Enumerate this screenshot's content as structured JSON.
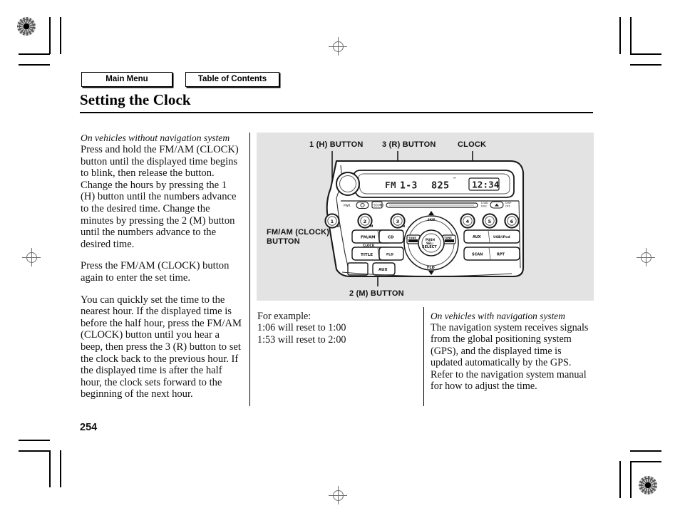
{
  "nav": {
    "main_menu": "Main Menu",
    "table_of_contents": "Table of Contents"
  },
  "header": {
    "title": "Setting the Clock"
  },
  "left_column": {
    "subhead": "On vehicles without navigation system",
    "paragraph_1": "Press and hold the FM/AM (CLOCK) button until the displayed time begins to blink, then release the button. Change the hours by pressing the 1 (H) button until the numbers advance to the desired time. Change the minutes by pressing the 2 (M) button until the numbers advance to the desired time.",
    "paragraph_2": "Press the FM/AM (CLOCK) button again to enter the set time.",
    "paragraph_3": "You can quickly set the time to the nearest hour. If the displayed time is before the half hour, press the FM/AM (CLOCK) button until you hear a beep, then press the 3 (R) button to set the clock back to the previous hour. If the displayed time is after the half hour, the clock sets forward to the beginning of the next hour."
  },
  "figure": {
    "labels": {
      "button_1h": "1 (H) BUTTON",
      "button_3r": "3 (R) BUTTON",
      "clock": "CLOCK",
      "fm_am_clock_line1": "FM/AM (CLOCK)",
      "fm_am_clock_line2": "BUTTON",
      "button_2m": "2 (M) BUTTON"
    },
    "display": {
      "band": "FM",
      "preset": "1-3",
      "frequency": "825",
      "unit": "″",
      "clock_time": "12:34"
    },
    "preset_buttons": [
      "1",
      "2",
      "3",
      "4",
      "5",
      "6"
    ],
    "preset_sublabels": [
      "H",
      "M",
      "R",
      "",
      "",
      ""
    ],
    "soft_buttons": {
      "fm_am": "FM/AM",
      "fm_am_sub": "CLOCK",
      "cd": "CD",
      "title": "TITLE",
      "folder": "FLD",
      "aux_right": "AUX",
      "usb_ipod": "USB/iPod",
      "scan": "SCAN",
      "rpt": "RPT",
      "aux_front": "AUX"
    },
    "wheel": {
      "up": "SKIP",
      "down": "FLD",
      "left": "TUNE",
      "right": "TUNE",
      "center_line1": "PUSH",
      "center_line2": "SEL/",
      "center_line3": "SELECT"
    },
    "top_row": {
      "power": "PWR",
      "sound": "SOUND",
      "eject": "EJECT",
      "disp_off": "DISP/OFF"
    }
  },
  "example_block": {
    "line_1": "For example:",
    "line_2": "1:06 will reset to 1:00",
    "line_3": "1:53 will reset to 2:00"
  },
  "nav_block": {
    "subhead": "On vehicles with navigation system",
    "paragraph": "The navigation system receives signals from the global positioning system (GPS), and the displayed time is updated automatically by the GPS. Refer to the navigation system manual for how to adjust the time."
  },
  "footer": {
    "page_number": "254"
  },
  "colors": {
    "figure_background": "#e3e3e3",
    "text": "#111111",
    "rule": "#000000"
  }
}
